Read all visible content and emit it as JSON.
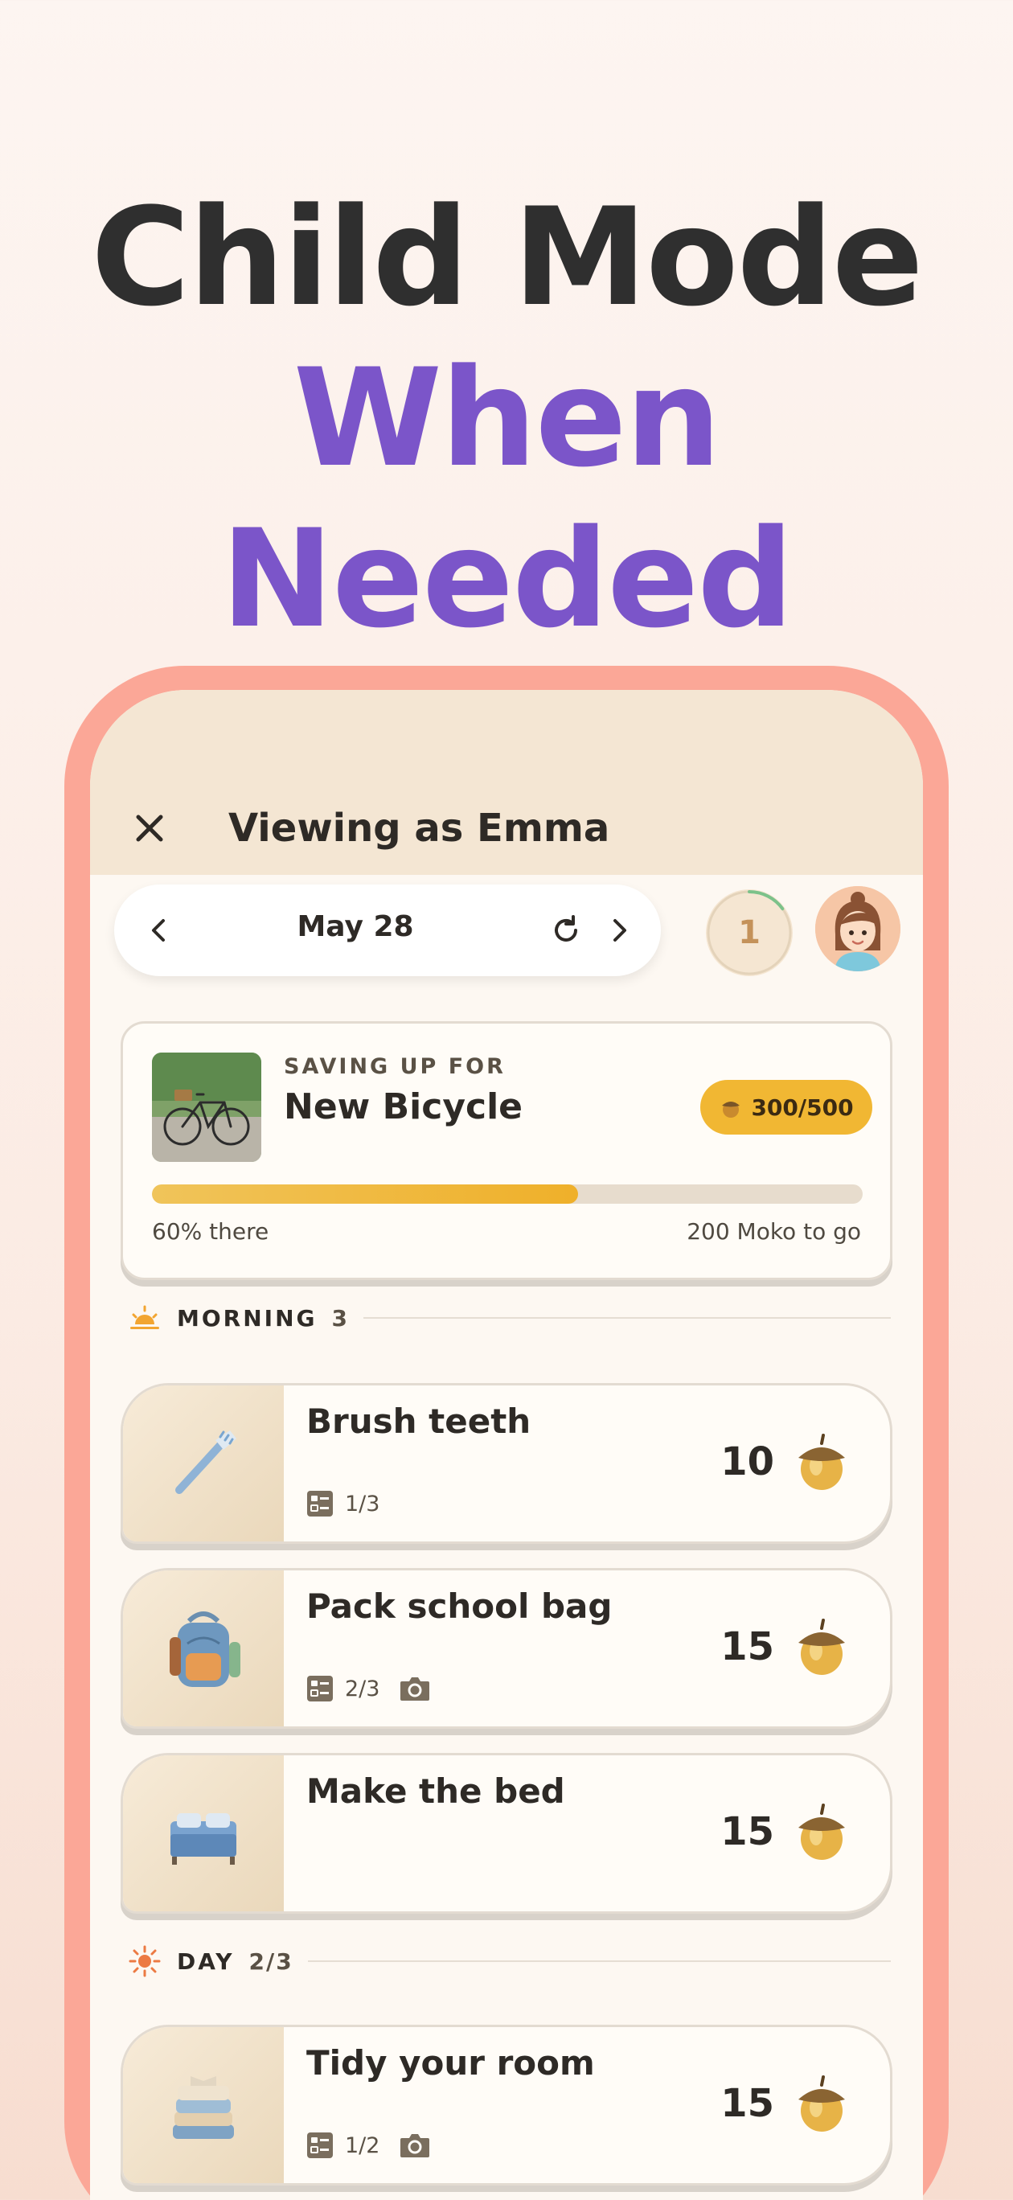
{
  "hero": {
    "line1": "Child Mode",
    "line2": "When Needed"
  },
  "header": {
    "close_icon": "close-icon",
    "title": "Viewing as Emma"
  },
  "datebar": {
    "date": "May 28"
  },
  "counter": {
    "value": "1",
    "progress": 0.15
  },
  "goal": {
    "kicker": "SAVING UP FOR",
    "title": "New Bicycle",
    "badge": "300/500",
    "progress": 0.6,
    "left_text": "60% there",
    "right_text": "200 Moko to go"
  },
  "sections": {
    "morning": {
      "label": "MORNING",
      "count": "3"
    },
    "day": {
      "label": "DAY",
      "count": "2/3"
    }
  },
  "tasks": [
    {
      "title": "Brush teeth",
      "checklist": "1/3",
      "photo": false,
      "points": "10",
      "icon": "toothbrush-icon"
    },
    {
      "title": "Pack school bag",
      "checklist": "2/3",
      "photo": true,
      "points": "15",
      "icon": "backpack-icon"
    },
    {
      "title": "Make the bed",
      "checklist": "",
      "photo": false,
      "points": "15",
      "icon": "bed-icon"
    },
    {
      "title": "Tidy your room",
      "checklist": "1/2",
      "photo": true,
      "points": "15",
      "icon": "folded-clothes-icon"
    }
  ],
  "colors": {
    "accent_purple": "#7b55c9",
    "phone_frame": "#fba797",
    "goal_badge": "#f1b733"
  }
}
